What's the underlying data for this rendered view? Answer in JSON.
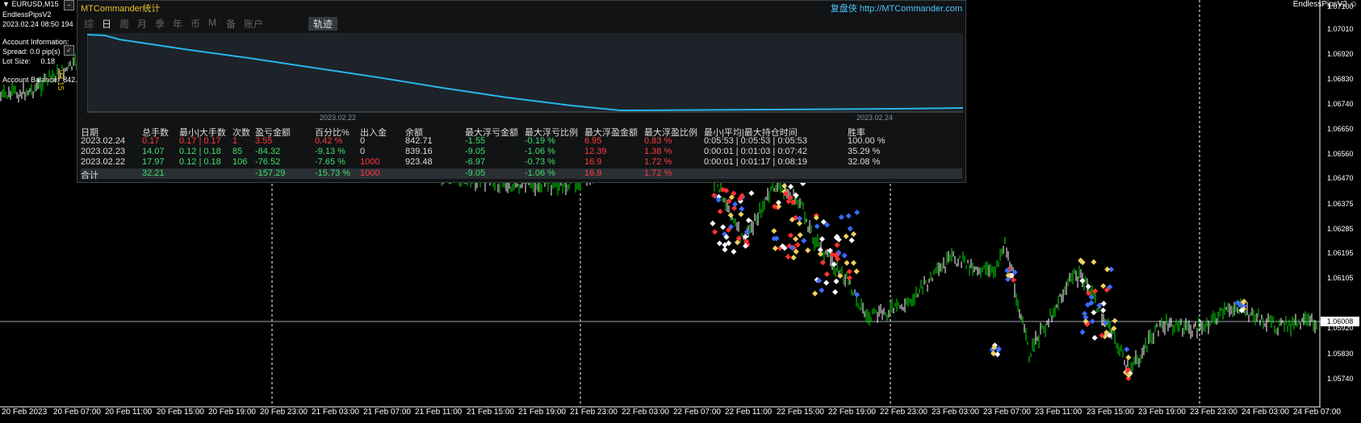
{
  "chart": {
    "symbol_timeframe": "EURUSD,M15",
    "ea_name": "EndlessPipsV2",
    "server_time": "2023.02.24 08:50",
    "server_extra": "194",
    "account_information": "Account Information:",
    "spread": "Spread: 0.0 pip(s)",
    "lot_size_label": "Lot Size:",
    "lot_size_value": "0.18",
    "account_balance_label": "Account Balance:",
    "account_balance_value": "842.71",
    "version": "V3.15",
    "ea_right_label": "EndlessPipsV2 ☺",
    "current_price": "1.06008",
    "price_axis": [
      "1.07100",
      "1.07010",
      "1.06920",
      "1.06830",
      "1.06740",
      "1.06650",
      "1.06560",
      "1.06470",
      "1.06375",
      "1.06285",
      "1.06195",
      "1.06105",
      "1.05920",
      "1.05830",
      "1.05740"
    ],
    "time_axis": [
      "20 Feb 2023",
      "20 Feb 07:00",
      "20 Feb 11:00",
      "20 Feb 15:00",
      "20 Feb 19:00",
      "20 Feb 23:00",
      "21 Feb 03:00",
      "21 Feb 07:00",
      "21 Feb 11:00",
      "21 Feb 15:00",
      "21 Feb 19:00",
      "21 Feb 23:00",
      "22 Feb 03:00",
      "22 Feb 07:00",
      "22 Feb 11:00",
      "22 Feb 15:00",
      "22 Feb 19:00",
      "22 Feb 23:00",
      "23 Feb 03:00",
      "23 Feb 07:00",
      "23 Feb 11:00",
      "23 Feb 15:00",
      "23 Feb 19:00",
      "23 Feb 23:00",
      "24 Feb 03:00",
      "24 Feb 07:00"
    ]
  },
  "panel": {
    "title": "MTCommander统计",
    "brand": "复盘侠 http://MTCommander.com",
    "tabs": [
      "综",
      "日",
      "周",
      "月",
      "季",
      "年",
      "币",
      "M",
      "备",
      "账户"
    ],
    "active_tab": "日",
    "track_tab": "轨迹",
    "graph_dates": [
      "2023.02.22",
      "2023.02.24"
    ],
    "headers": [
      "日期",
      "总手数",
      "最小|大手数",
      "次数",
      "盈亏金额",
      "百分比%",
      "出入金",
      "余额",
      "最大浮亏金额",
      "最大浮亏比例",
      "最大浮盈金额",
      "最大浮盈比例",
      "最小|平均|最大持仓时间",
      "胜率"
    ],
    "rows": [
      [
        "2023.02.24",
        "0.17",
        "0.17 | 0.17",
        "1",
        "3.55",
        "0.42 %",
        "0",
        "842.71",
        "-1.55",
        "-0.19 %",
        "6.95",
        "0.83 %",
        "0:05:53 | 0:05:53 | 0:05:53",
        "100.00 %"
      ],
      [
        "2023.02.23",
        "14.07",
        "0.12 | 0.18",
        "85",
        "-84.32",
        "-9.13 %",
        "0",
        "839.16",
        "-9.05",
        "-1.06 %",
        "12.39",
        "1.38 %",
        "0:00:01 | 0:01:03 | 0:07:42",
        "35.29 %"
      ],
      [
        "2023.02.22",
        "17.97",
        "0.12 | 0.18",
        "106",
        "-76.52",
        "-7.65 %",
        "1000",
        "923.48",
        "-6.97",
        "-0.73 %",
        "16.9",
        "1.72 %",
        "0:00:01 | 0:01:17 | 0:08:19",
        "32.08 %"
      ]
    ],
    "total": [
      "合计",
      "32.21",
      "",
      "",
      "-157.29",
      "-15.73 %",
      "1000",
      "",
      "-9.05",
      "-1.06 %",
      "16.9",
      "1.72 %",
      "",
      ""
    ]
  },
  "colors": {
    "background": "#000000",
    "candle": "#00e000",
    "grid": "#ffffff",
    "equity": "#2ab4e8",
    "title_gold": "#e8c12e",
    "brand_blue": "#4fc3ff",
    "positive": "#3fe06a",
    "negative": "#ff3b3b"
  }
}
